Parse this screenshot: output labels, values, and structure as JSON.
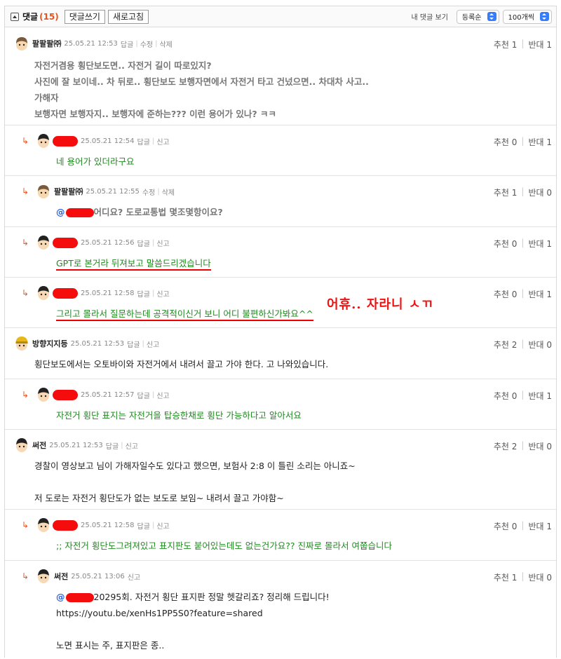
{
  "toolbar": {
    "title": "댓글",
    "count": "(15)",
    "write_label": "댓글쓰기",
    "refresh_label": "새로고침",
    "my_comments_label": "내 댓글 보기",
    "sort_value": "등록순",
    "page_size_value": "100개씩"
  },
  "vote_labels": {
    "up": "추천",
    "down": "반대"
  },
  "comments": [
    {
      "nick": "팔팔팔㈜",
      "date": "25.05.21 12:53",
      "actions": [
        "답글",
        "수정",
        "삭제"
      ],
      "up": "1",
      "down": "1",
      "lines": [
        "자전거겸용 횡단보도면.. 자전거 길이 따로있지?",
        "사진에 잘 보이네.. 차 뒤로.. 횡단보도 보행자면에서 자전거 타고 건넜으면.. 차대차 사고..",
        "가해자",
        "보행자면 보행자지.. 보행자에 준하는??? 이런 용어가 있나? ㅋㅋ"
      ]
    },
    {
      "nick": "",
      "date": "25.05.21 12:54",
      "actions": [
        "답글",
        "신고"
      ],
      "up": "0",
      "down": "1",
      "lines": [
        "네 용어가 있더라구요"
      ]
    },
    {
      "nick": "팔팔팔㈜",
      "date": "25.05.21 12:55",
      "actions": [
        "수정",
        "삭제"
      ],
      "up": "1",
      "down": "0",
      "mention": "@",
      "text_after_mention": "어디요? 도로교통법 몇조몇항이요?"
    },
    {
      "nick": "",
      "date": "25.05.21 12:56",
      "actions": [
        "답글",
        "신고"
      ],
      "up": "0",
      "down": "1",
      "lines": [
        "GPT로 본거라 뒤져보고 말씀드리겠습니다"
      ]
    },
    {
      "nick": "",
      "date": "25.05.21 12:58",
      "actions": [
        "답글",
        "신고"
      ],
      "up": "0",
      "down": "1",
      "lines": [
        "그리고 몰라서 질문하는데 공격적이신거 보니 어디 불편하신가봐요^^"
      ],
      "annotation": "어휴.. 자라니 ㅅㄲ"
    },
    {
      "nick": "방향지지등",
      "date": "25.05.21 12:53",
      "actions": [
        "답글",
        "신고"
      ],
      "up": "2",
      "down": "0",
      "lines": [
        "횡단보도에서는 오토바이와 자전거에서 내려서 끌고 가야 한다. 고 나와있습니다."
      ]
    },
    {
      "nick": "",
      "date": "25.05.21 12:57",
      "actions": [
        "답글",
        "신고"
      ],
      "up": "0",
      "down": "1",
      "lines": [
        "자전거 횡단 표지는 자전거을 탑승한채로 횡단 가능하다고 알아서요"
      ]
    },
    {
      "nick": "써전",
      "date": "25.05.21 12:53",
      "actions": [
        "답글",
        "신고"
      ],
      "up": "2",
      "down": "0",
      "lines": [
        "경찰이 영상보고 님이 가해자일수도 있다고 했으면, 보험사 2:8 이 틀린 소리는 아니죠~",
        "",
        "저 도로는 자전거 횡단도가 없는 보도로 보임~ 내려서 끌고 가야함~"
      ]
    },
    {
      "nick": "",
      "date": "25.05.21 12:58",
      "actions": [
        "답글",
        "신고"
      ],
      "up": "0",
      "down": "1",
      "lines": [
        ";; 자전거 횡단도그려져있고 표지판도 붙어있는데도 없는건가요?? 진짜로 몰라서 여쭙습니다"
      ]
    },
    {
      "nick": "써전",
      "date": "25.05.21 13:06",
      "actions": [
        "신고"
      ],
      "up": "1",
      "down": "0",
      "mention": "@",
      "text_after_mention": "20295회. 자전거 횡단 표지판 정말 헷갈리죠? 정리해 드립니다!",
      "lines": [
        "https://youtu.be/xenHs1PP5S0?feature=shared",
        "",
        "노면 표시는 주, 표지판은 종.."
      ]
    }
  ]
}
